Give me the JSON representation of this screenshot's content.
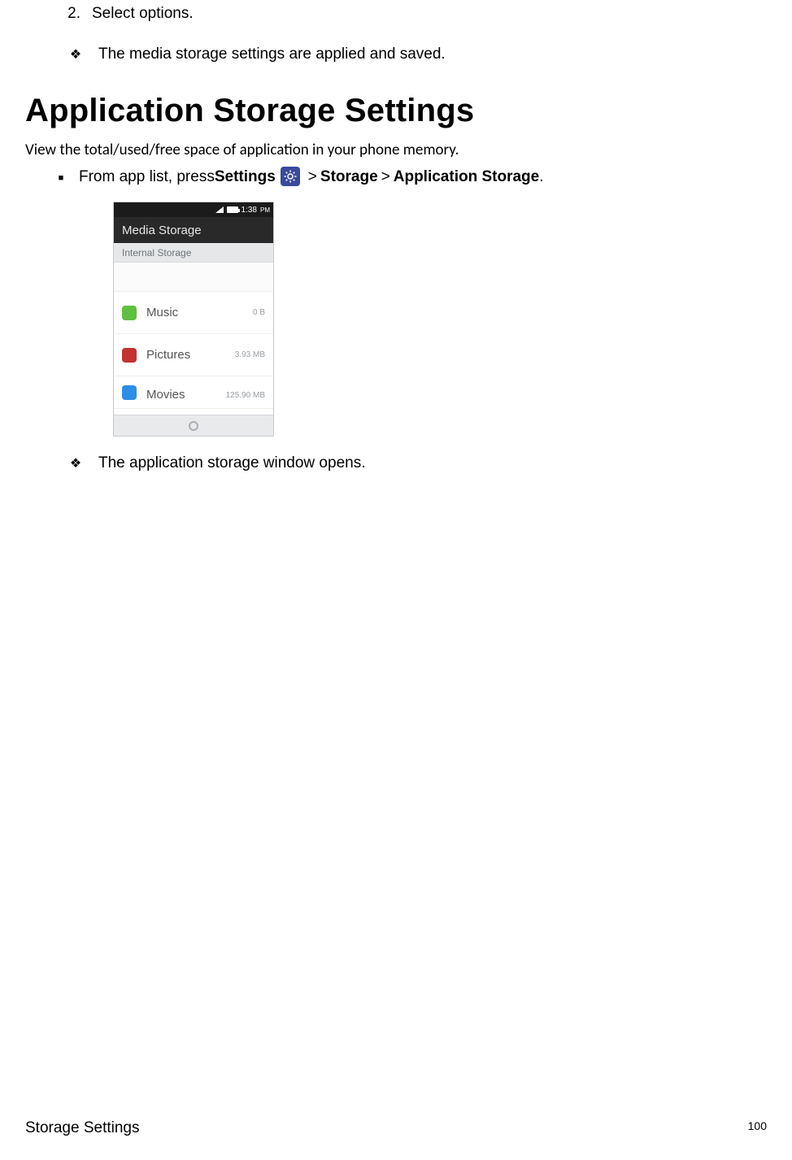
{
  "step": {
    "num": "2.",
    "text": "Select options."
  },
  "result1": "The media storage settings are applied and saved.",
  "heading": "Application Storage Settings",
  "intro": "View the total/used/free space of application in your phone memory.",
  "sub": {
    "prefix": "From app list, press ",
    "settings": "Settings",
    "storage": "Storage",
    "appstorage": "Application Storage",
    "gt": ">",
    "period": "."
  },
  "phone": {
    "time": "1:38",
    "ampm": "PM",
    "title": "Media Storage",
    "subheader": "Internal Storage",
    "rows": [
      {
        "label": "Music",
        "size": "0 B",
        "swatch": "sw-green"
      },
      {
        "label": "Pictures",
        "size": "3.93 MB",
        "swatch": "sw-red"
      },
      {
        "label": "Movies",
        "size": "125.90 MB",
        "swatch": "sw-blue"
      }
    ]
  },
  "result2": "The application storage window opens.",
  "footer": {
    "section": "Storage Settings",
    "page": "100"
  }
}
